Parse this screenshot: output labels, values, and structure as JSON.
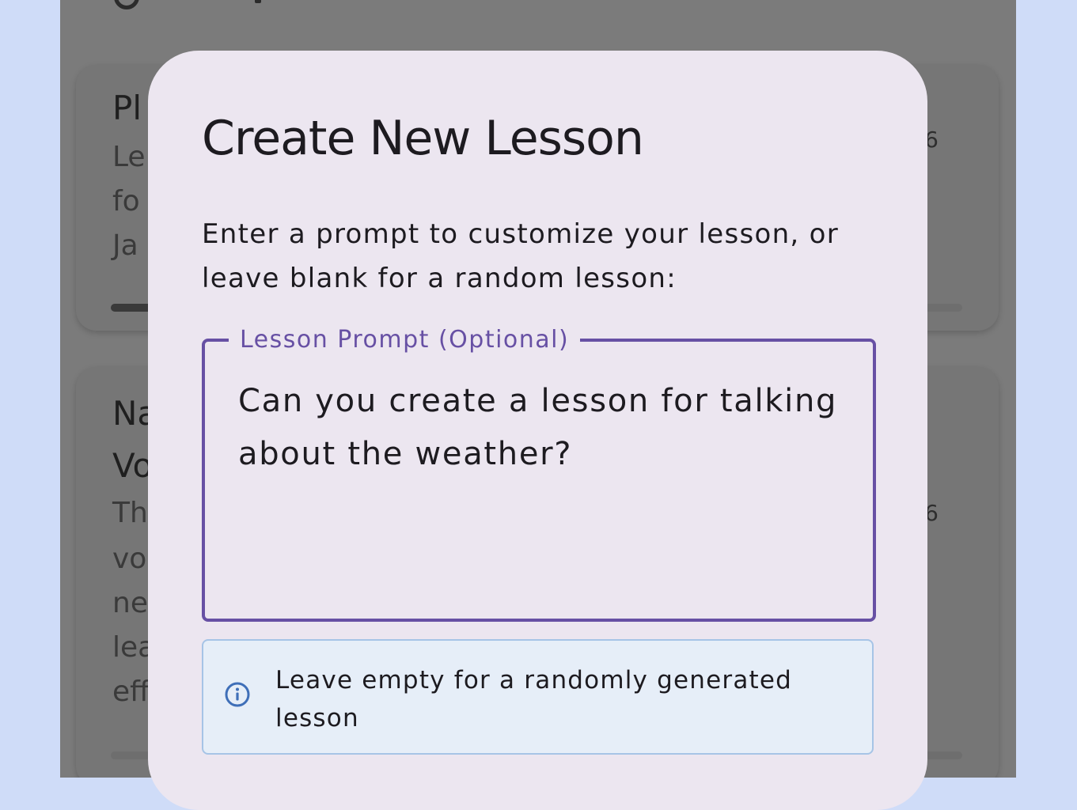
{
  "background_screen": {
    "cards": [
      {
        "title_fragment": "Pl",
        "lines": [
          "Le",
          "fo",
          "Ja"
        ],
        "count_fragment": "6",
        "progress_fraction": 0.25
      },
      {
        "title_lines": [
          "Na",
          "Vo"
        ],
        "lines": [
          "Th",
          "vo",
          "ne",
          "lea",
          "eff"
        ],
        "count_fragment": "6"
      }
    ]
  },
  "dialog": {
    "title": "Create New Lesson",
    "description": "Enter a prompt to customize your lesson, or leave blank for a random lesson:",
    "prompt_field": {
      "label": "Lesson Prompt (Optional)",
      "value": "Can you create a lesson for talking about the weather?"
    },
    "info": {
      "icon": "info-icon",
      "text": "Leave empty for a randomly generated lesson"
    }
  },
  "colors": {
    "accent": "#6750a4",
    "dialog_bg": "#ece6f0",
    "info_bg": "#e6eef8",
    "info_icon": "#3f6fb8",
    "scrim": "#7b7b7b",
    "outer_bg": "#cfdcf8"
  }
}
